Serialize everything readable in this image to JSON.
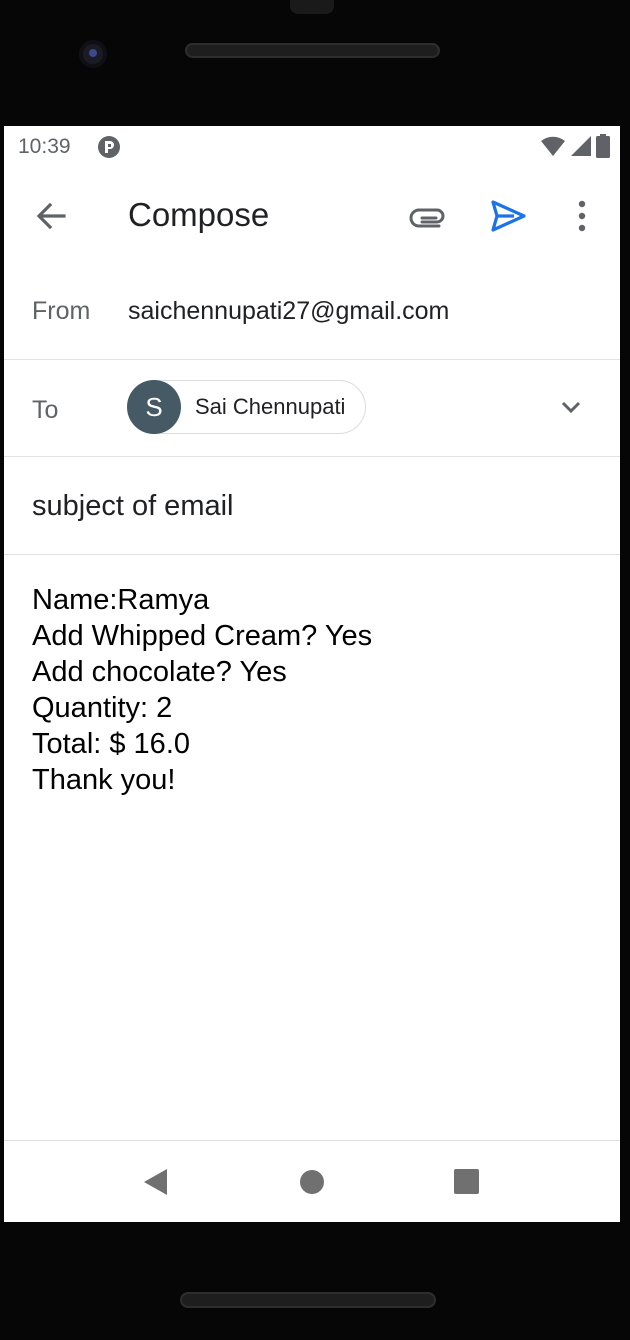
{
  "status_bar": {
    "time": "10:39",
    "icons": [
      "app-notification-icon",
      "wifi-icon",
      "cell-signal-icon",
      "battery-icon"
    ]
  },
  "app_bar": {
    "title": "Compose",
    "actions": [
      "back-arrow-icon",
      "attachment-icon",
      "send-icon",
      "more-vert-icon"
    ],
    "send_color": "#1a73e8"
  },
  "from": {
    "label": "From",
    "value": "saichennupati27@gmail.com"
  },
  "to": {
    "label": "To",
    "recipient": {
      "initial": "S",
      "name": "Sai Chennupati",
      "avatar_color": "#455a64"
    }
  },
  "subject": {
    "value": "subject of email"
  },
  "body": {
    "lines": [
      "Name:Ramya",
      "Add Whipped Cream? Yes",
      "Add chocolate? Yes",
      "Quantity: 2",
      "Total: $ 16.0",
      "Thank you!"
    ]
  },
  "nav_bar": {
    "buttons": [
      "nav-back-icon",
      "nav-home-icon",
      "nav-recents-icon"
    ]
  }
}
